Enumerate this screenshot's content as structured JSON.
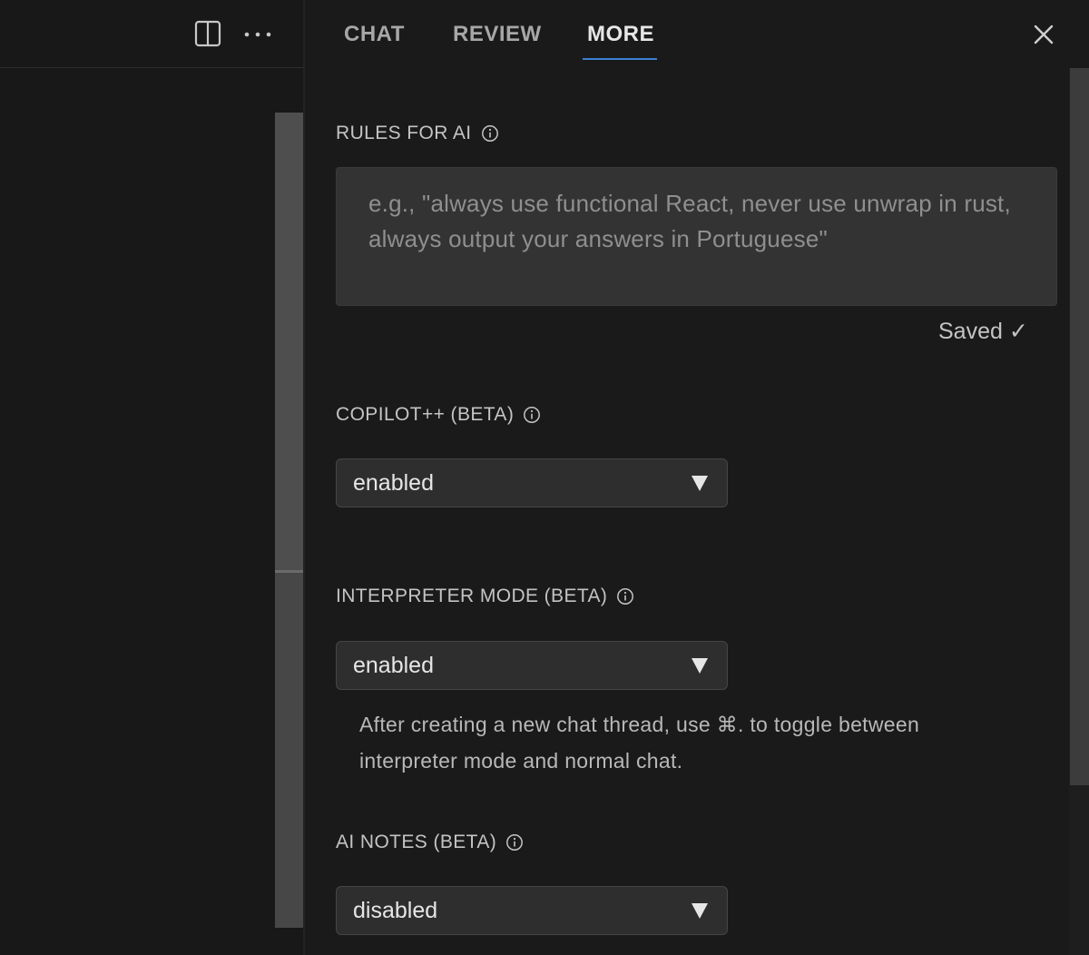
{
  "left_toolbar": {
    "split_icon": "split-editor-icon",
    "more_icon": "more-horizontal-icon"
  },
  "tabs": [
    {
      "label": "CHAT",
      "active": false
    },
    {
      "label": "REVIEW",
      "active": false
    },
    {
      "label": "MORE",
      "active": true
    }
  ],
  "accent_color": "#3b7fd4",
  "close_icon": "close-icon",
  "rules_for_ai": {
    "label": "RULES FOR AI",
    "placeholder": "e.g., \"always use functional React, never use unwrap in rust, always output your answers in Portuguese\"",
    "value": "",
    "status": "Saved ✓"
  },
  "copilot": {
    "label": "COPILOT++ (BETA)",
    "value": "enabled"
  },
  "interpreter": {
    "label": "INTERPRETER MODE (BETA)",
    "value": "enabled",
    "help": "After creating a new chat thread, use ⌘. to toggle between interpreter mode and normal chat."
  },
  "ai_notes": {
    "label": "AI NOTES (BETA)",
    "value": "disabled"
  }
}
